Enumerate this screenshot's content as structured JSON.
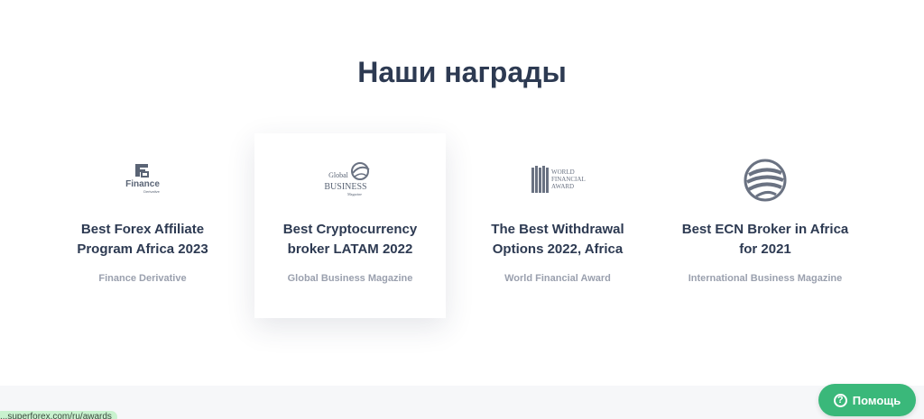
{
  "section": {
    "title": "Наши награды"
  },
  "awards": [
    {
      "title": "Best Forex Affiliate Program Africa 2023",
      "source": "Finance Derivative",
      "logo_icon": "finance-derivative-logo-icon",
      "logo_text_main": "Finance",
      "logo_text_sub": "Derivative"
    },
    {
      "title": "Best Cryptocurrency broker LATAM 2022",
      "source": "Global Business Magazine",
      "logo_icon": "global-business-logo-icon",
      "logo_text_top": "Global",
      "logo_text_main": "BUSINESS",
      "logo_text_sub": "Magazine"
    },
    {
      "title": "The Best Withdrawal Options 2022, Africa",
      "source": "World Financial Award",
      "logo_icon": "world-financial-award-logo-icon",
      "logo_text_lines": [
        "WORLD",
        "FINANCIAL",
        "AWARD"
      ]
    },
    {
      "title": "Best ECN Broker in Africa for 2021",
      "source": "International Business Magazine",
      "logo_icon": "globe-logo-icon"
    }
  ],
  "status_bar": {
    "url": "...superforex.com/ru/awards"
  },
  "help_button": {
    "label": "Помощь",
    "icon": "question-circle-icon"
  },
  "colors": {
    "heading": "#2d3a52",
    "source_text": "#9aa0ae",
    "help_button_bg": "#3ab87a",
    "status_bg": "#c9f2cf"
  }
}
